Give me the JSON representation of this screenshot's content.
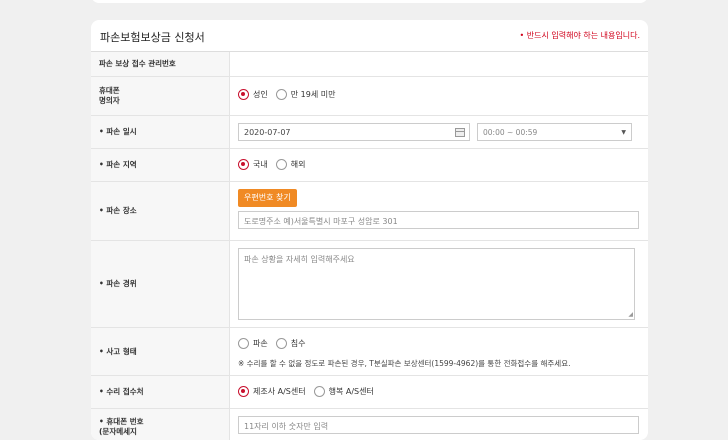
{
  "form": {
    "title": "파손보험보상금 신청서",
    "required_note": "• 반드시 입력해야 하는 내용입니다.",
    "rows": {
      "receipt_no": {
        "label": "파손 보상 접수 관리번호"
      },
      "owner": {
        "label_line1": "휴대폰",
        "label_line2": "명의자",
        "options": [
          "성인",
          "만 19세 미만"
        ],
        "selected": "성인"
      },
      "date": {
        "label": "• 파손 일시",
        "date_value": "2020-07-07",
        "time_value": "00:00 ~ 00:59"
      },
      "region": {
        "label": "• 파손 지역",
        "options": [
          "국내",
          "해외"
        ],
        "selected": "국내"
      },
      "place": {
        "label": "• 파손 장소",
        "zip_button": "우편번호 찾기",
        "address_placeholder": "도로명주소 예)서울특별시 마포구 성암로 301"
      },
      "details": {
        "label": "• 파손 경위",
        "placeholder": "파손 상황을 자세히 입력해주세요"
      },
      "accident_type": {
        "label": "• 사고 형태",
        "options": [
          "파손",
          "침수"
        ],
        "selected": "",
        "notice": "※ 수리를 할 수 없을 정도로 파손된 경우, T분실파손 보상센터(1599-4962)를 통한 전화접수를 해주세요."
      },
      "repair_center": {
        "label": "• 수리 접수처",
        "options": [
          "제조사 A/S센터",
          "행복 A/S센터"
        ],
        "selected": "제조사 A/S센터"
      },
      "phone": {
        "label_line1": "• 휴대폰 번호",
        "label_line2": "(문자메세지",
        "placeholder": "11자리 이하 숫자만 입력"
      }
    }
  },
  "colors": {
    "accent": "#c8102e",
    "button": "#f08a24",
    "required": "#d0021b"
  }
}
